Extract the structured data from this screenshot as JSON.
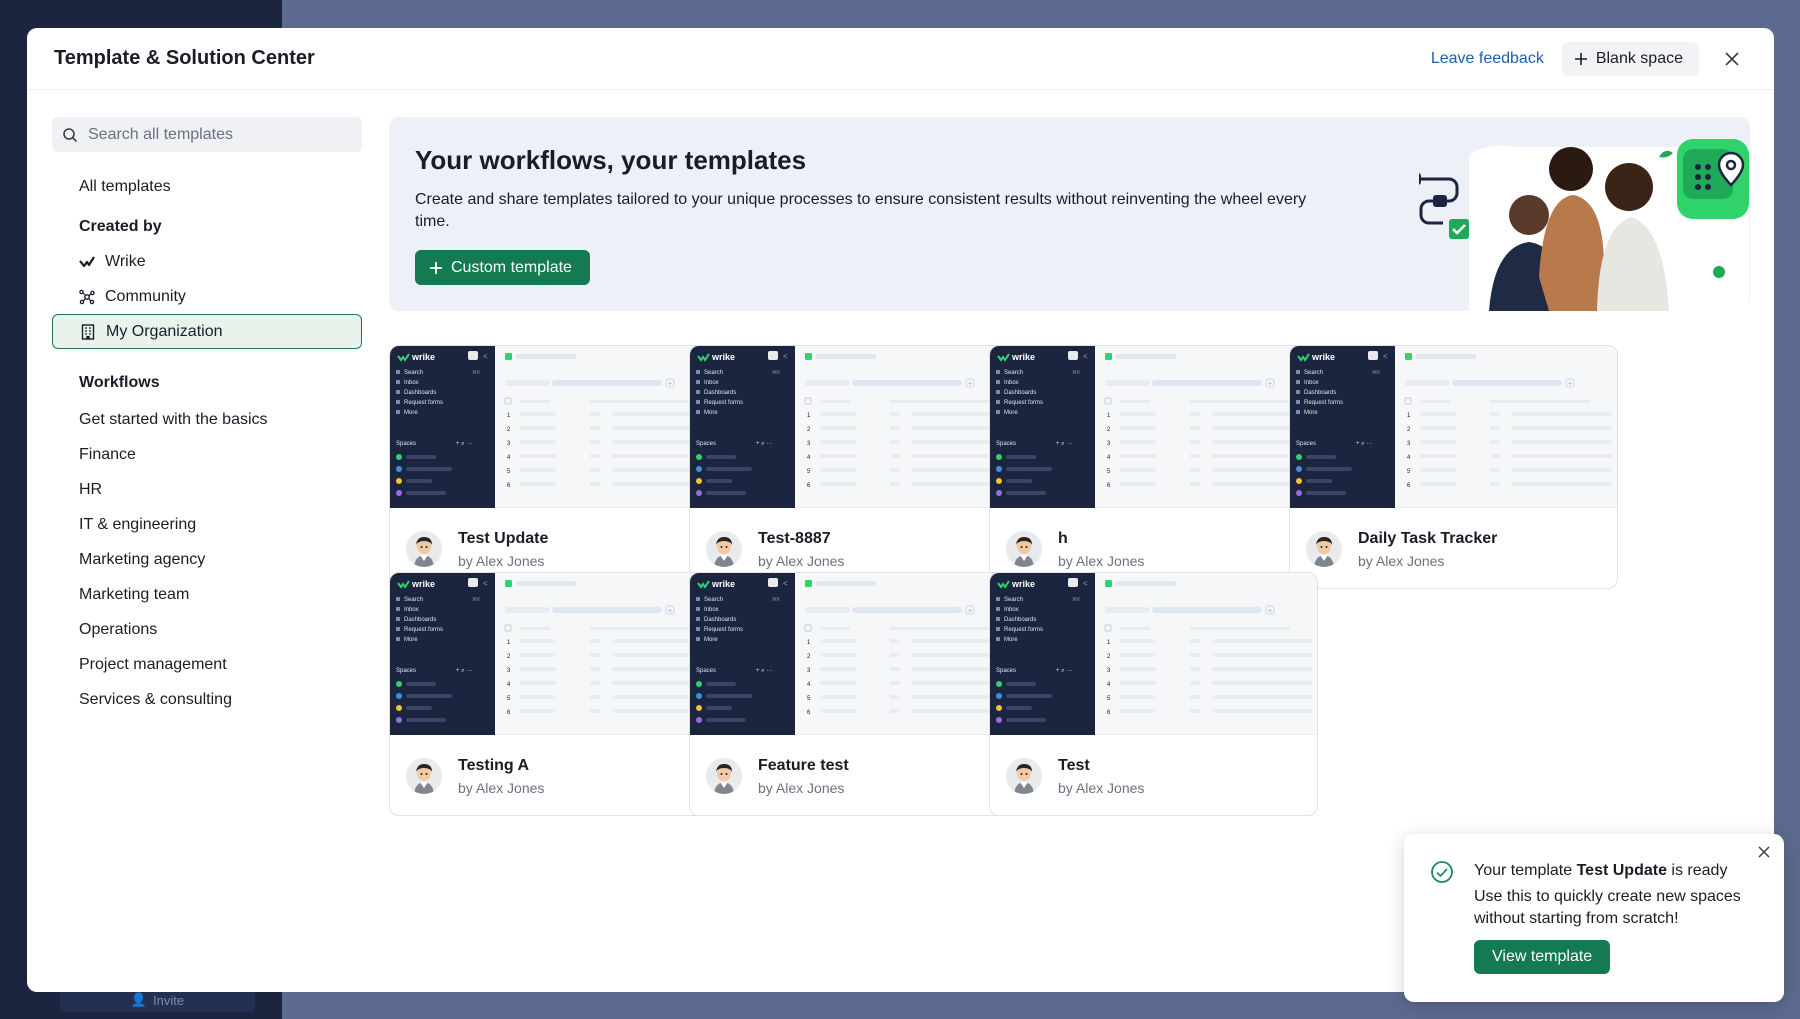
{
  "backdrop": {
    "invite_label": "Invite"
  },
  "modal": {
    "title": "Template & Solution Center",
    "feedback_label": "Leave feedback",
    "blank_space_label": "Blank space"
  },
  "sidebar": {
    "search_placeholder": "Search all templates",
    "all_templates": "All templates",
    "created_by_heading": "Created by",
    "created_by": [
      {
        "label": "Wrike",
        "icon": "wrike-check-icon"
      },
      {
        "label": "Community",
        "icon": "community-icon"
      },
      {
        "label": "My Organization",
        "icon": "building-icon",
        "active": true
      }
    ],
    "workflows_heading": "Workflows",
    "workflows": [
      "Get started with the basics",
      "Finance",
      "HR",
      "IT & engineering",
      "Marketing agency",
      "Marketing team",
      "Operations",
      "Project management",
      "Services & consulting"
    ]
  },
  "banner": {
    "title": "Your workflows, your templates",
    "description": "Create and share templates tailored to your unique processes to ensure consistent results without reinventing the wheel every time.",
    "custom_template_label": "Custom template"
  },
  "thumbnail": {
    "logo": "wrike",
    "menu": [
      "Search",
      "Inbox",
      "Dashboards",
      "Request forms",
      "More"
    ],
    "spaces_label": "Spaces",
    "rows": [
      "1",
      "2",
      "3",
      "4",
      "5",
      "6"
    ]
  },
  "cards": [
    {
      "name": "Test Update",
      "author": "by Alex Jones"
    },
    {
      "name": "Test-8887",
      "author": "by Alex Jones"
    },
    {
      "name": "h",
      "author": "by Alex Jones"
    },
    {
      "name": "Daily Task Tracker",
      "author": "by Alex Jones"
    },
    {
      "name": "Testing A",
      "author": "by Alex Jones"
    },
    {
      "name": "Feature test",
      "author": "by Alex Jones"
    },
    {
      "name": "Test",
      "author": "by Alex Jones"
    }
  ],
  "toast": {
    "title_prefix": "Your template ",
    "title_name": "Test Update",
    "title_suffix": " is ready",
    "body": "Use this to quickly create new spaces without starting from scratch!",
    "button_label": "View template"
  },
  "colors": {
    "accent": "#137a52",
    "link": "#1d5fa8",
    "sidebar_dark": "#1b2540",
    "overlay": "#5d6a8f",
    "success_icon": "#1f8a5a"
  }
}
